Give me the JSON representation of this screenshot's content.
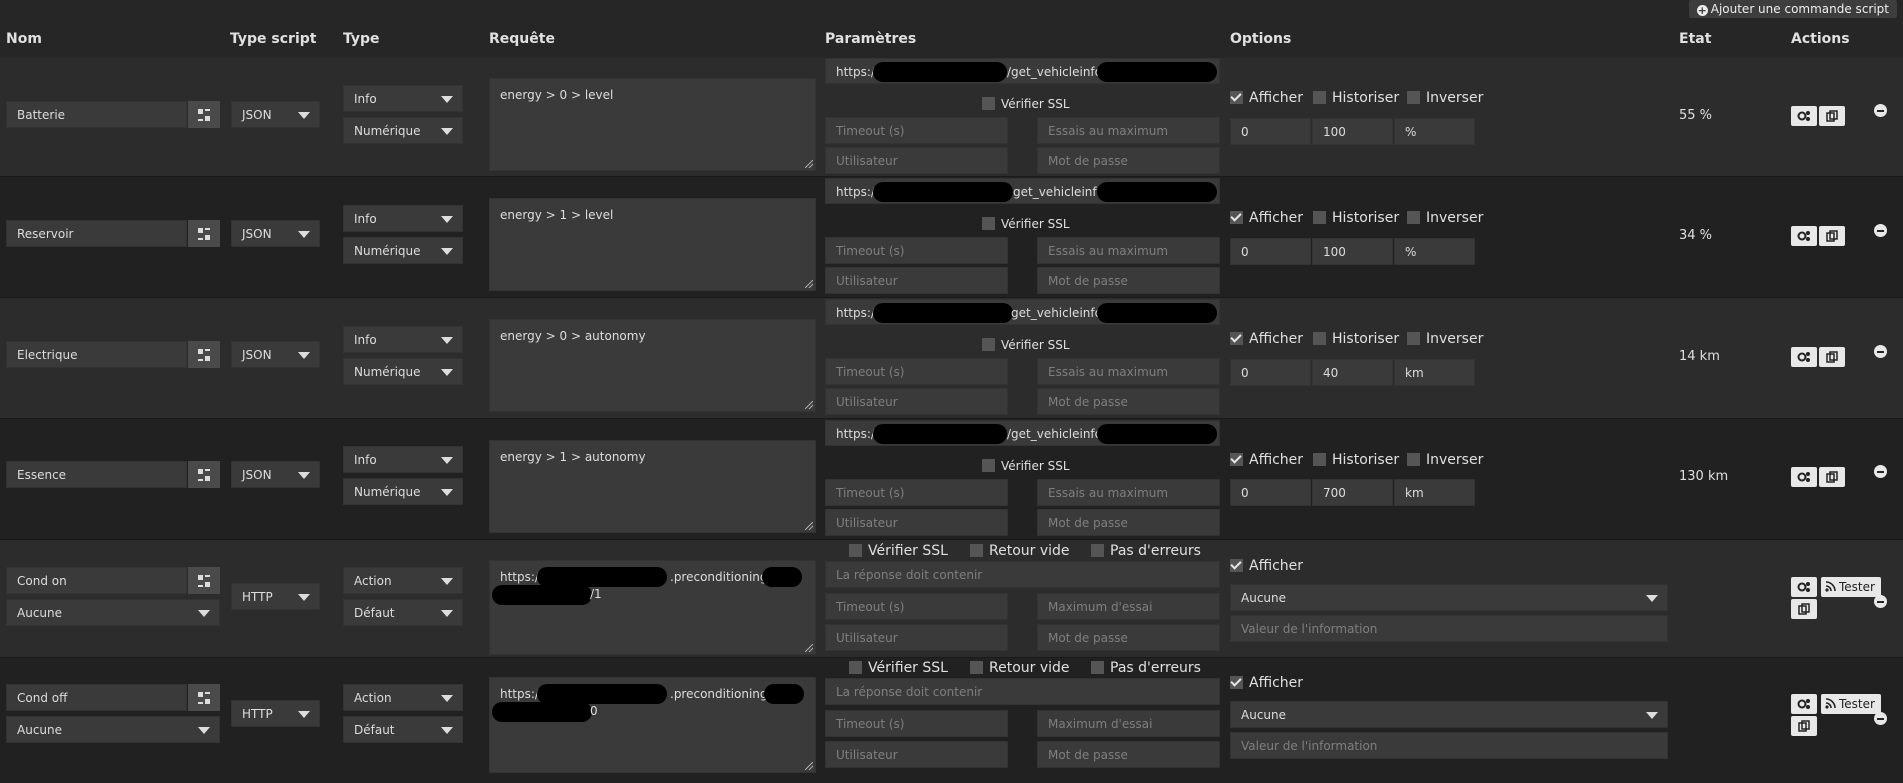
{
  "toolbar": {
    "add_command_label": "Ajouter une commande script"
  },
  "headers": {
    "nom": "Nom",
    "type_script": "Type script",
    "type": "Type",
    "requete": "Requête",
    "parametres": "Paramètres",
    "options": "Options",
    "etat": "Etat",
    "actions": "Actions"
  },
  "labels": {
    "verifier_ssl": "Vérifier SSL",
    "retour_vide": "Retour vide",
    "pas_erreurs": "Pas d'erreurs",
    "afficher": "Afficher",
    "historiser": "Historiser",
    "inverser": "Inverser",
    "timeout_ph": "Timeout (s)",
    "essais_ph": "Essais au maximum",
    "maximum_essai_ph": "Maximum d'essai",
    "utilisateur_ph": "Utilisateur",
    "motdepasse_ph": "Mot de passe",
    "reponse_ph": "La réponse doit contenir",
    "valeur_info_ph": "Valeur de l'information",
    "tester": "Tester"
  },
  "rows": [
    {
      "name": "Batterie",
      "script_type": "JSON",
      "type": "Info",
      "subtype": "Numérique",
      "request": "energy > 0 > level",
      "url_prefix": "https:/",
      "url_mid": "/get_vehicleinfo/",
      "min": "0",
      "max": "100",
      "unit": "%",
      "etat": "55 %"
    },
    {
      "name": "Reservoir",
      "script_type": "JSON",
      "type": "Info",
      "subtype": "Numérique",
      "request": "energy > 1 > level",
      "url_prefix": "https:/",
      "url_mid": "get_vehicleinfo",
      "min": "0",
      "max": "100",
      "unit": "%",
      "etat": "34 %"
    },
    {
      "name": "Electrique",
      "script_type": "JSON",
      "type": "Info",
      "subtype": "Numérique",
      "request": "energy > 0 > autonomy",
      "url_prefix": "https:/",
      "url_mid": "get_vehicleinfo,",
      "min": "0",
      "max": "40",
      "unit": "km",
      "etat": "14 km"
    },
    {
      "name": "Essence",
      "script_type": "JSON",
      "type": "Info",
      "subtype": "Numérique",
      "request": "energy > 1 > autonomy",
      "url_prefix": "https:/",
      "url_mid": "/get_vehicleinfo/",
      "min": "0",
      "max": "700",
      "unit": "km",
      "etat": "130 km"
    },
    {
      "name": "Cond on",
      "sub_select": "Aucune",
      "script_type": "HTTP",
      "type": "Action",
      "subtype": "Défaut",
      "request_a": "https:/",
      "request_b": ".preconditioning/",
      "request_c": "/1",
      "action_select": "Aucune"
    },
    {
      "name": "Cond off",
      "sub_select": "Aucune",
      "script_type": "HTTP",
      "type": "Action",
      "subtype": "Défaut",
      "request_a": "https:/",
      "request_b": ".preconditioning/",
      "request_c": "0",
      "action_select": "Aucune"
    }
  ]
}
